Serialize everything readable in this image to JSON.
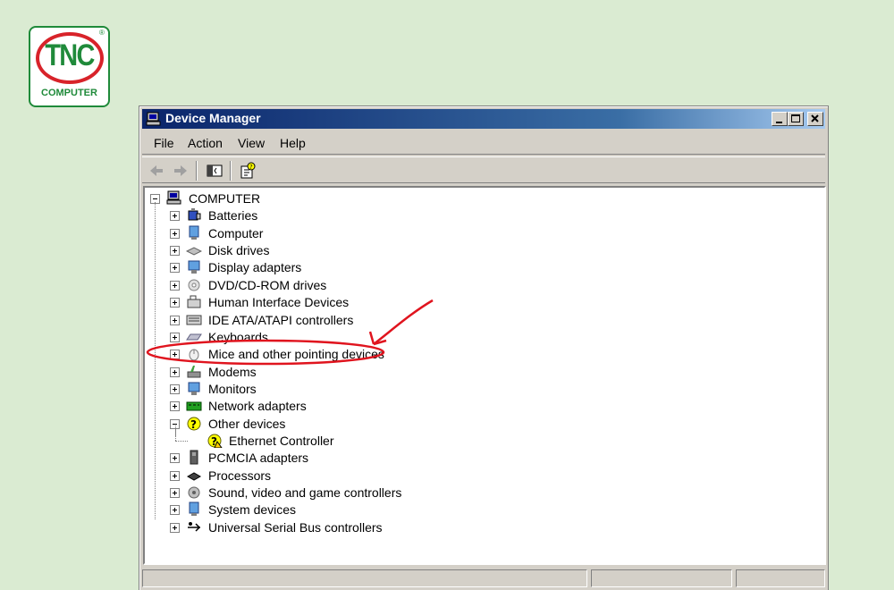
{
  "logo": {
    "text": "TNC",
    "subtext": "COMPUTER",
    "registered": "®"
  },
  "window": {
    "title": "Device Manager",
    "menu": [
      "File",
      "Action",
      "View",
      "Help"
    ],
    "tree": {
      "root": "COMPUTER",
      "categories": [
        {
          "label": "Batteries",
          "icon": "battery-icon"
        },
        {
          "label": "Computer",
          "icon": "computer-icon"
        },
        {
          "label": "Disk drives",
          "icon": "disk-drive-icon"
        },
        {
          "label": "Display adapters",
          "icon": "display-adapter-icon"
        },
        {
          "label": "DVD/CD-ROM drives",
          "icon": "dvd-drive-icon"
        },
        {
          "label": "Human Interface Devices",
          "icon": "hid-icon"
        },
        {
          "label": "IDE ATA/ATAPI controllers",
          "icon": "ide-controller-icon"
        },
        {
          "label": "Keyboards",
          "icon": "keyboard-icon"
        },
        {
          "label": "Mice and other pointing devices",
          "icon": "mouse-icon"
        },
        {
          "label": "Modems",
          "icon": "modem-icon"
        },
        {
          "label": "Monitors",
          "icon": "monitor-icon"
        },
        {
          "label": "Network adapters",
          "icon": "network-adapter-icon"
        },
        {
          "label": "Other devices",
          "icon": "unknown-device-icon",
          "expanded": true,
          "children": [
            {
              "label": "Ethernet Controller",
              "icon": "unknown-device-warning-icon"
            }
          ]
        },
        {
          "label": "PCMCIA adapters",
          "icon": "pcmcia-icon"
        },
        {
          "label": "Processors",
          "icon": "processor-icon"
        },
        {
          "label": "Sound, video and game controllers",
          "icon": "sound-icon"
        },
        {
          "label": "System devices",
          "icon": "system-device-icon"
        },
        {
          "label": "Universal Serial Bus controllers",
          "icon": "usb-icon"
        }
      ]
    },
    "toolbar": [
      "back-arrow-icon",
      "forward-arrow-icon",
      "show-hide-tree-icon",
      "properties-icon"
    ]
  },
  "colors": {
    "annotation": "#e0141e",
    "titlebar": "#0a246a",
    "background": "#daebd2"
  }
}
